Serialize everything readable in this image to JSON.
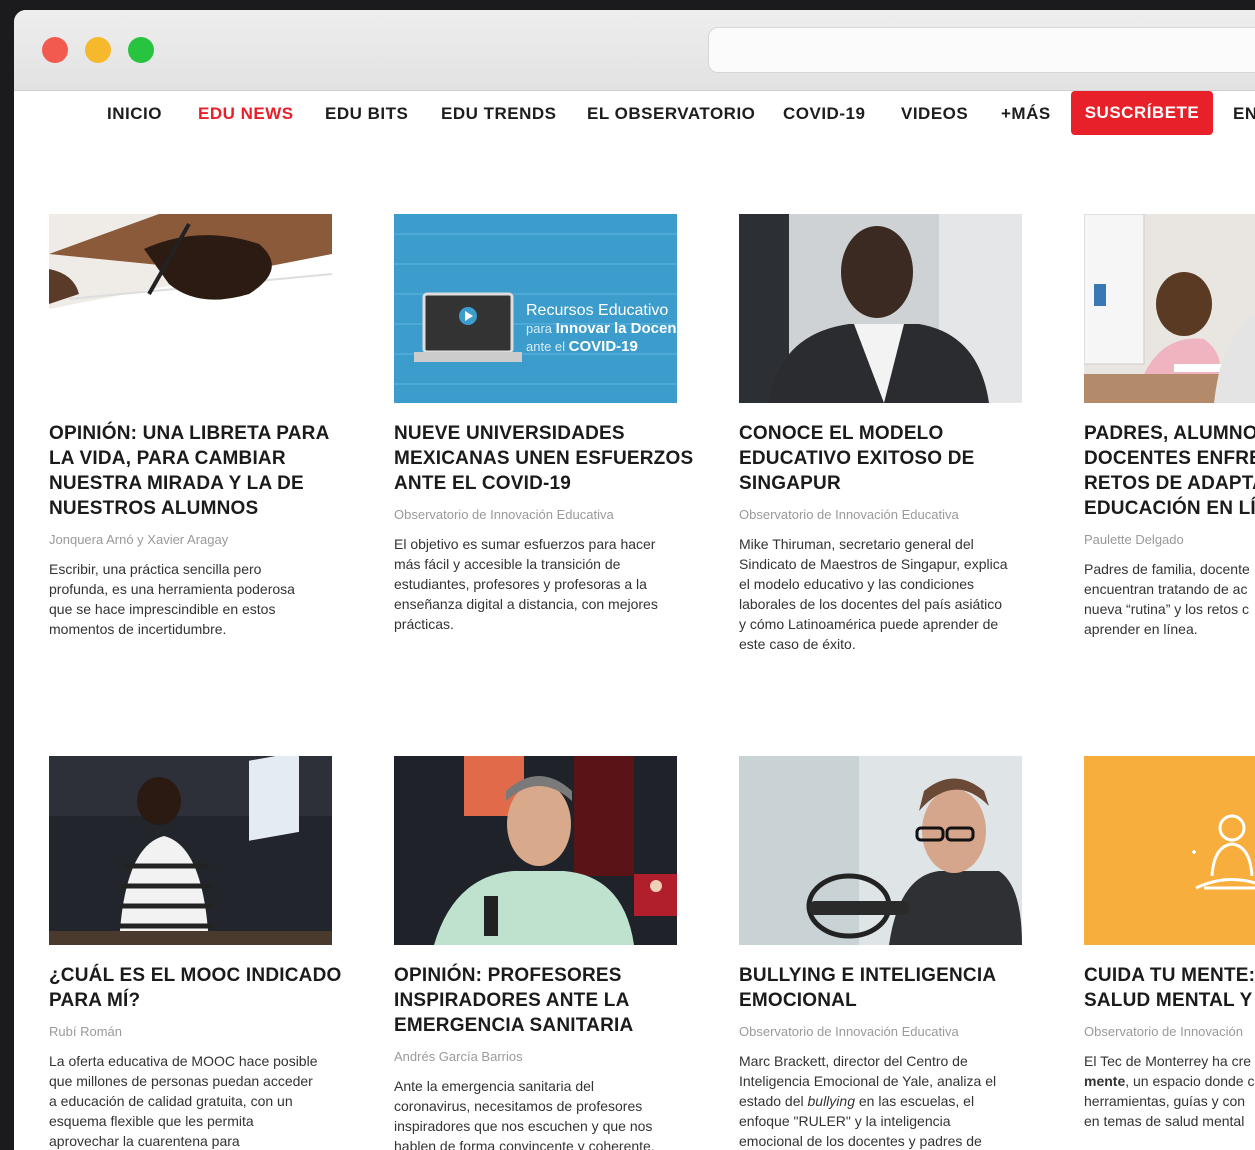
{
  "nav": {
    "items": [
      "INICIO",
      "EDU NEWS",
      "EDU BITS",
      "EDU TRENDS",
      "EL OBSERVATORIO",
      "COVID-19",
      "VIDEOS",
      "+MÁS"
    ],
    "active_index": 1,
    "subscribe_label": "SUSCRÍBETE",
    "language_label": "EN"
  },
  "articles": [
    {
      "title_lines": [
        "OPINIÓN: UNA LIBRETA PARA",
        "LA VIDA, PARA CAMBIAR",
        "NUESTRA MIRADA Y LA DE",
        "NUESTROS ALUMNOS"
      ],
      "author": "Jonquera Arnó y Xavier Aragay",
      "excerpt_lines": [
        "Escribir, una práctica sencilla pero",
        "profunda, es una herramienta poderosa",
        "que se hace imprescindible en estos",
        "momentos de incertidumbre."
      ]
    },
    {
      "title_lines": [
        "NUEVE UNIVERSIDADES",
        "MEXICANAS UNEN ESFUERZOS",
        "ANTE EL COVID-19"
      ],
      "author": "Observatorio de Innovación Educativa",
      "excerpt_lines": [
        "El objetivo es sumar esfuerzos para hacer",
        "más fácil y accesible la transición de",
        "estudiantes, profesores y profesoras a la",
        "enseñanza digital a distancia, con mejores",
        "prácticas."
      ],
      "thumb_text": {
        "line1": "Recursos Educativo",
        "line2_pre": "para ",
        "line2_bold": "Innovar la Docen",
        "line3_pre": "ante el ",
        "line3_bold": "COVID-19"
      }
    },
    {
      "title_lines": [
        "CONOCE EL MODELO",
        "EDUCATIVO EXITOSO DE",
        "SINGAPUR"
      ],
      "author": "Observatorio de Innovación Educativa",
      "excerpt_lines": [
        "Mike Thiruman, secretario general del",
        "Sindicato de Maestros de Singapur, explica",
        "el modelo educativo y las condiciones",
        "laborales de los docentes del país asiático",
        "y cómo Latinoamérica puede aprender de",
        "este caso de éxito."
      ]
    },
    {
      "title_lines": [
        "PADRES, ALUMNOS",
        "DOCENTES ENFREN",
        "RETOS DE ADAPTAR",
        "EDUCACIÓN EN LÍN"
      ],
      "author": "Paulette Delgado",
      "excerpt_lines": [
        "Padres de familia, docente",
        "encuentran tratando de ac",
        "nueva “rutina” y los retos c",
        "aprender en línea."
      ]
    },
    {
      "title_lines": [
        "¿CUÁL ES EL MOOC INDICADO",
        "PARA MÍ?"
      ],
      "author": "Rubí Román",
      "excerpt_lines": [
        "La oferta educativa de MOOC hace posible",
        "que millones de personas puedan acceder",
        "a educación de calidad gratuita, con un",
        "esquema flexible que les permita",
        "aprovechar la cuarentena para"
      ]
    },
    {
      "title_lines": [
        "OPINIÓN: PROFESORES",
        "INSPIRADORES ANTE LA",
        "EMERGENCIA SANITARIA"
      ],
      "author": "Andrés García Barrios",
      "excerpt_lines": [
        "Ante la emergencia sanitaria del",
        "coronavirus, necesitamos de profesores",
        "inspiradores que nos escuchen y que nos",
        "hablen de forma convincente y coherente."
      ]
    },
    {
      "title_lines": [
        "BULLYING E INTELIGENCIA",
        "EMOCIONAL"
      ],
      "author": "Observatorio de Innovación Educativa",
      "excerpt_lines": [
        "Marc Brackett, director del Centro de",
        "Inteligencia Emocional de Yale, analiza el",
        "estado del bullying en las escuelas, el",
        "enfoque \"RULER\" y la inteligencia",
        "emocional de los docentes y padres de"
      ]
    },
    {
      "title_lines": [
        "CUIDA TU MENTE: U",
        "SALUD MENTAL Y E"
      ],
      "author": "Observatorio de Innovación",
      "excerpt_lines": [
        "El Tec de Monterrey ha cre",
        "mente, un espacio donde c",
        "herramientas, guías y con",
        "en temas de salud mental"
      ]
    }
  ],
  "colors": {
    "accent": "#e8202a",
    "thumb_orange": "#f8ae3d",
    "thumb_blue": "#3c9ccc"
  }
}
